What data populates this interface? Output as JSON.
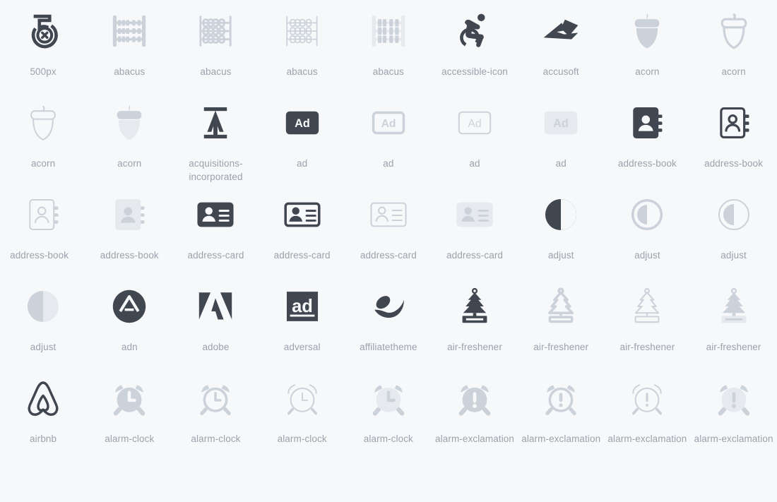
{
  "page": {
    "title": "Font Awesome Icon Gallery",
    "background_color": "#f7f8fa",
    "label_color": "#9aa2ac",
    "columns": 9,
    "rows": 5
  },
  "styles": {
    "solid": "#414750",
    "regular": "#ccd2da",
    "light": "#ccd2da",
    "duotone_primary": "#ccd2da",
    "duotone_secondary": "#e6e9ee",
    "brand": "#414750"
  },
  "icons": [
    {
      "name": "500px",
      "label": "500px",
      "style": "brand",
      "glyph": "500px"
    },
    {
      "name": "abacus",
      "label": "abacus",
      "style": "solid-light",
      "glyph": "abacus-solid"
    },
    {
      "name": "abacus",
      "label": "abacus",
      "style": "regular",
      "glyph": "abacus-regular"
    },
    {
      "name": "abacus",
      "label": "abacus",
      "style": "light",
      "glyph": "abacus-light"
    },
    {
      "name": "abacus",
      "label": "abacus",
      "style": "duotone",
      "glyph": "abacus-duotone"
    },
    {
      "name": "accessible-icon",
      "label": "accessible-icon",
      "style": "brand",
      "glyph": "accessible-icon"
    },
    {
      "name": "accusoft",
      "label": "accusoft",
      "style": "brand",
      "glyph": "accusoft"
    },
    {
      "name": "acorn",
      "label": "acorn",
      "style": "solid-light",
      "glyph": "acorn-solid"
    },
    {
      "name": "acorn",
      "label": "acorn",
      "style": "regular",
      "glyph": "acorn-regular"
    },
    {
      "name": "acorn",
      "label": "acorn",
      "style": "light",
      "glyph": "acorn-light"
    },
    {
      "name": "acorn",
      "label": "acorn",
      "style": "duotone",
      "glyph": "acorn-duotone"
    },
    {
      "name": "acquisitions-incorporated",
      "label": "acquisitions-incorporated",
      "style": "brand",
      "glyph": "acquisitions-incorporated"
    },
    {
      "name": "ad",
      "label": "ad",
      "style": "solid",
      "glyph": "ad-solid"
    },
    {
      "name": "ad",
      "label": "ad",
      "style": "regular",
      "glyph": "ad-regular"
    },
    {
      "name": "ad",
      "label": "ad",
      "style": "light",
      "glyph": "ad-light"
    },
    {
      "name": "ad",
      "label": "ad",
      "style": "duotone",
      "glyph": "ad-duotone"
    },
    {
      "name": "address-book",
      "label": "address-book",
      "style": "solid",
      "glyph": "address-book-solid"
    },
    {
      "name": "address-book",
      "label": "address-book",
      "style": "regular-dark",
      "glyph": "address-book-regular"
    },
    {
      "name": "address-book",
      "label": "address-book",
      "style": "light",
      "glyph": "address-book-light"
    },
    {
      "name": "address-book",
      "label": "address-book",
      "style": "duotone",
      "glyph": "address-book-duotone"
    },
    {
      "name": "address-card",
      "label": "address-card",
      "style": "solid",
      "glyph": "address-card-solid"
    },
    {
      "name": "address-card",
      "label": "address-card",
      "style": "regular-dark",
      "glyph": "address-card-regular"
    },
    {
      "name": "address-card",
      "label": "address-card",
      "style": "light",
      "glyph": "address-card-light"
    },
    {
      "name": "address-card",
      "label": "address-card",
      "style": "duotone",
      "glyph": "address-card-duotone"
    },
    {
      "name": "adjust",
      "label": "adjust",
      "style": "solid",
      "glyph": "adjust-solid"
    },
    {
      "name": "adjust",
      "label": "adjust",
      "style": "regular",
      "glyph": "adjust-regular"
    },
    {
      "name": "adjust",
      "label": "adjust",
      "style": "light",
      "glyph": "adjust-light"
    },
    {
      "name": "adjust",
      "label": "adjust",
      "style": "duotone",
      "glyph": "adjust-duotone"
    },
    {
      "name": "adn",
      "label": "adn",
      "style": "brand",
      "glyph": "adn"
    },
    {
      "name": "adobe",
      "label": "adobe",
      "style": "brand",
      "glyph": "adobe"
    },
    {
      "name": "adversal",
      "label": "adversal",
      "style": "brand",
      "glyph": "adversal"
    },
    {
      "name": "affiliatetheme",
      "label": "affiliatetheme",
      "style": "brand",
      "glyph": "affiliatetheme"
    },
    {
      "name": "air-freshener",
      "label": "air-freshener",
      "style": "solid",
      "glyph": "air-freshener-solid"
    },
    {
      "name": "air-freshener",
      "label": "air-freshener",
      "style": "regular",
      "glyph": "air-freshener-regular"
    },
    {
      "name": "air-freshener",
      "label": "air-freshener",
      "style": "light",
      "glyph": "air-freshener-light"
    },
    {
      "name": "air-freshener",
      "label": "air-freshener",
      "style": "duotone",
      "glyph": "air-freshener-duotone"
    },
    {
      "name": "airbnb",
      "label": "airbnb",
      "style": "brand",
      "glyph": "airbnb"
    },
    {
      "name": "alarm-clock",
      "label": "alarm-clock",
      "style": "solid-light",
      "glyph": "alarm-clock-solid"
    },
    {
      "name": "alarm-clock",
      "label": "alarm-clock",
      "style": "regular",
      "glyph": "alarm-clock-regular"
    },
    {
      "name": "alarm-clock",
      "label": "alarm-clock",
      "style": "light",
      "glyph": "alarm-clock-light"
    },
    {
      "name": "alarm-clock",
      "label": "alarm-clock",
      "style": "duotone",
      "glyph": "alarm-clock-duotone"
    },
    {
      "name": "alarm-exclamation",
      "label": "alarm-exclamation",
      "style": "solid-light",
      "glyph": "alarm-exclamation-solid"
    },
    {
      "name": "alarm-exclamation",
      "label": "alarm-exclamation",
      "style": "regular",
      "glyph": "alarm-exclamation-regular"
    },
    {
      "name": "alarm-exclamation",
      "label": "alarm-exclamation",
      "style": "light",
      "glyph": "alarm-exclamation-light"
    },
    {
      "name": "alarm-exclamation",
      "label": "alarm-exclamation",
      "style": "duotone",
      "glyph": "alarm-exclamation-duotone"
    }
  ]
}
